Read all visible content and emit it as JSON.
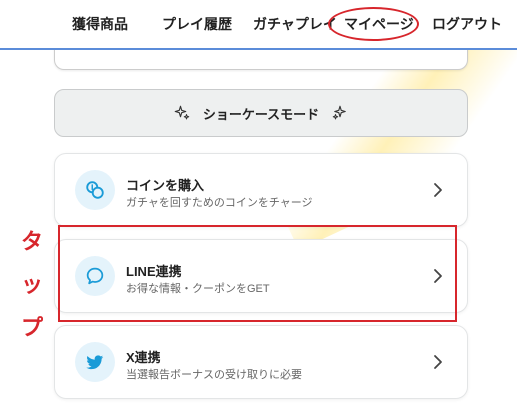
{
  "nav": {
    "items": [
      "獲得商品",
      "プレイ履歴",
      "ガチャプレイ",
      "マイページ",
      "ログアウト"
    ]
  },
  "showcase": {
    "label": "ショーケースモード"
  },
  "menu": [
    {
      "title": "コインを購入",
      "subtitle": "ガチャを回すためのコインをチャージ",
      "icon": "coins-icon"
    },
    {
      "title": "LINE連携",
      "subtitle": "お得な情報・クーポンをGET",
      "icon": "chat-bubble-icon"
    },
    {
      "title": "X連携",
      "subtitle": "当選報告ボーナスの受け取りに必要",
      "icon": "bird-icon"
    }
  ],
  "annotation": {
    "label": [
      "タ",
      "ッ",
      "プ"
    ]
  },
  "colors": {
    "accent_blue": "#1a9bd7",
    "annotation_red": "#d7262c",
    "nav_border": "#5b8cd9"
  }
}
